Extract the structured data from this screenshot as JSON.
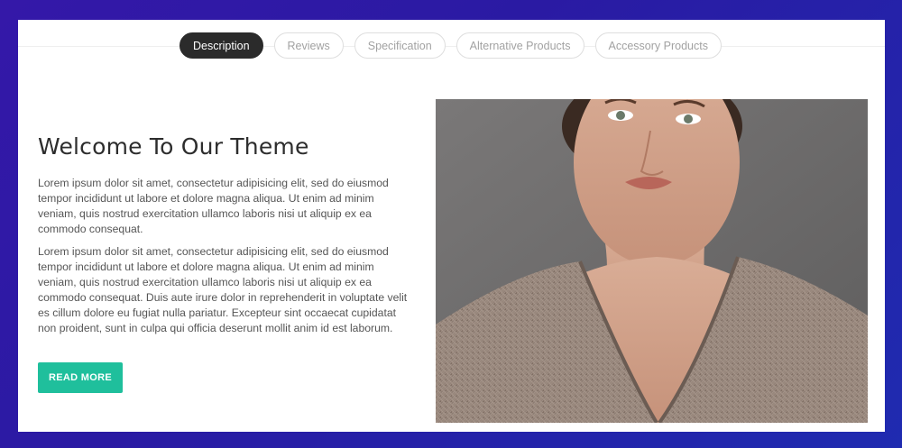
{
  "tabs": [
    {
      "label": "Description",
      "active": true
    },
    {
      "label": "Reviews",
      "active": false
    },
    {
      "label": "Specification",
      "active": false
    },
    {
      "label": "Alternative Products",
      "active": false
    },
    {
      "label": "Accessory Products",
      "active": false
    }
  ],
  "main": {
    "title": "Welcome To Our Theme",
    "paragraphs": [
      "Lorem ipsum dolor sit amet, consectetur adipisicing elit, sed do eiusmod tempor incididunt ut labore et dolore magna aliqua. Ut enim ad minim veniam, quis nostrud exercitation ullamco laboris nisi ut aliquip ex ea commodo consequat.",
      "Lorem ipsum dolor sit amet, consectetur adipisicing elit, sed do eiusmod tempor incididunt ut labore et dolore magna aliqua. Ut enim ad minim veniam, quis nostrud exercitation ullamco laboris nisi ut aliquip ex ea commodo consequat. Duis aute irure dolor in reprehenderit in voluptate velit es cillum dolore eu fugiat nulla pariatur. Excepteur sint occaecat cupidatat non proident, sunt in culpa qui officia deserunt mollit anim id est laborum."
    ],
    "read_more_label": "READ MORE"
  },
  "colors": {
    "background_gradient_start": "#3418a8",
    "background_gradient_end": "#1f2bb0",
    "active_tab": "#2b2b2b",
    "button": "#1fbf9c"
  }
}
